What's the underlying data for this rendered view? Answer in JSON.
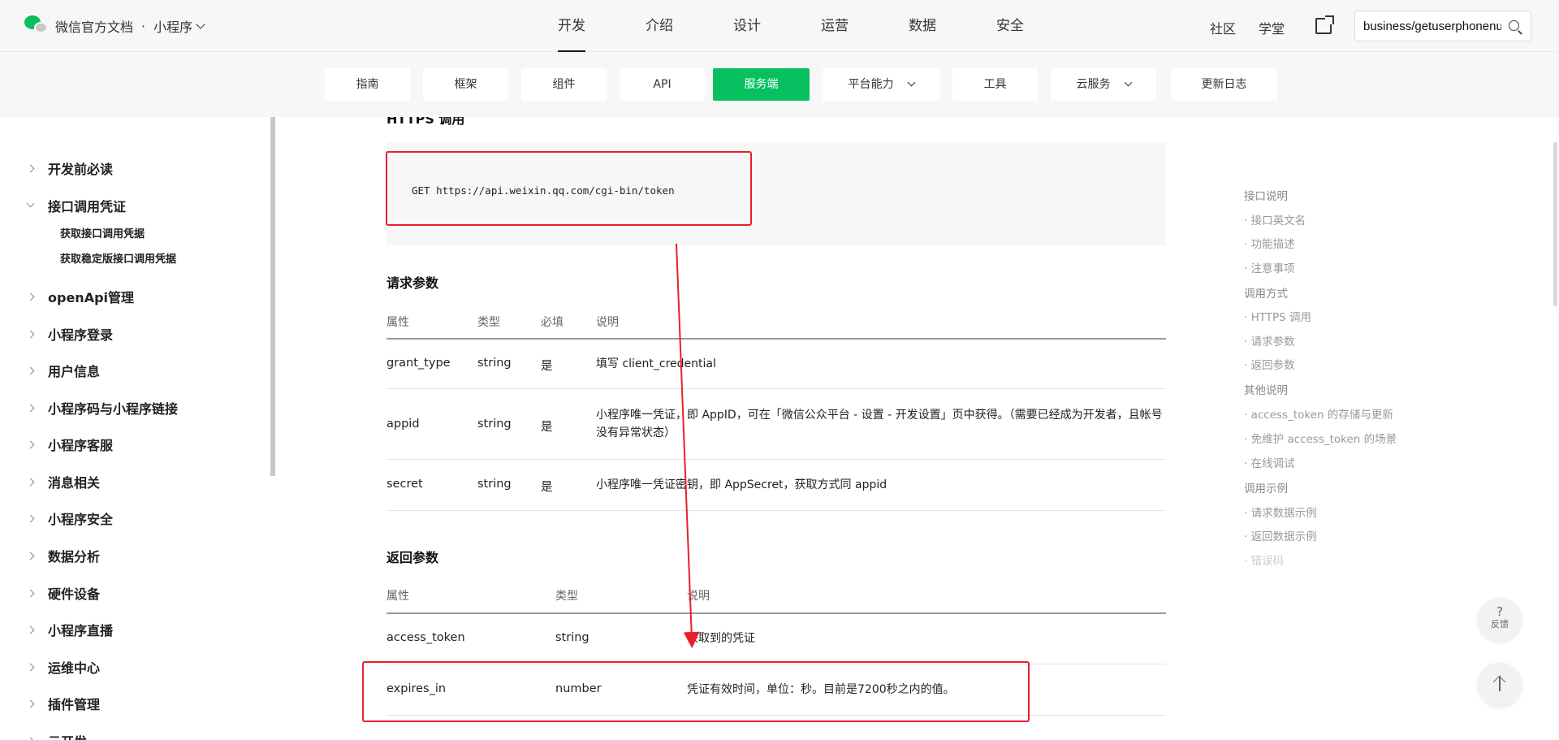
{
  "header": {
    "brand": "微信官方文档",
    "separator": "·",
    "product": "小程序",
    "nav": [
      "开发",
      "介绍",
      "设计",
      "运营",
      "数据",
      "安全"
    ],
    "nav_active": "开发",
    "right_links": [
      "社区",
      "学堂"
    ],
    "search_value": "business/getuserphonenumber"
  },
  "subnav": {
    "tabs": [
      "指南",
      "框架",
      "组件",
      "API",
      "服务端",
      "平台能力",
      "工具",
      "云服务",
      "更新日志"
    ],
    "active": "服务端"
  },
  "sidebar": {
    "items": [
      "开发前必读",
      "接口调用凭证",
      "openApi管理",
      "小程序登录",
      "用户信息",
      "小程序码与小程序链接",
      "小程序客服",
      "消息相关",
      "小程序安全",
      "数据分析",
      "硬件设备",
      "小程序直播",
      "运维中心",
      "插件管理",
      "云开发"
    ],
    "sub_items": [
      "获取接口调用凭据",
      "获取稳定版接口调用凭据"
    ]
  },
  "content": {
    "https_title": "HTTPS 调用",
    "request_line": "GET https://api.weixin.qq.com/cgi-bin/token",
    "request_params_title": "请求参数",
    "request_headers": [
      "属性",
      "类型",
      "必填",
      "说明"
    ],
    "request_rows": [
      {
        "name": "grant_type",
        "type": "string",
        "required": "是",
        "desc": "填写 client_credential"
      },
      {
        "name": "appid",
        "type": "string",
        "required": "是",
        "desc": "小程序唯一凭证，即 AppID，可在「微信公众平台 - 设置 - 开发设置」页中获得。（需要已经成为开发者，且帐号没有异常状态）"
      },
      {
        "name": "secret",
        "type": "string",
        "required": "是",
        "desc": "小程序唯一凭证密钥，即 AppSecret，获取方式同 appid"
      }
    ],
    "response_params_title": "返回参数",
    "response_headers": [
      "属性",
      "类型",
      "说明"
    ],
    "response_rows": [
      {
        "name": "access_token",
        "type": "string",
        "desc": "获取到的凭证"
      },
      {
        "name": "expires_in",
        "type": "number",
        "desc": "凭证有效时间，单位：秒。目前是7200秒之内的值。"
      }
    ]
  },
  "toc": {
    "items": [
      "接口说明",
      "· 接口英文名",
      "· 功能描述",
      "· 注意事项",
      "调用方式",
      "· HTTPS 调用",
      "· 请求参数",
      "· 返回参数",
      "其他说明",
      "· access_token 的存储与更新",
      "· 免维护 access_token 的场景",
      "· 在线调试",
      "调用示例",
      "· 请求数据示例",
      "· 返回数据示例",
      "· 错误码"
    ]
  },
  "floating": {
    "feedback_q": "?",
    "feedback_label": "反馈"
  },
  "colors": {
    "accent": "#07c160",
    "annotation": "#e8202a"
  }
}
